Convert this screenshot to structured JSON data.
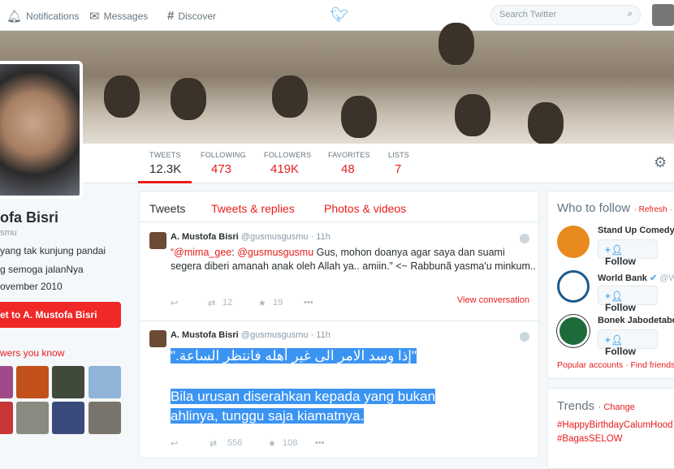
{
  "topbar": {
    "notifications": "Notifications",
    "messages": "Messages",
    "discover": "Discover",
    "search_placeholder": "Search Twitter"
  },
  "stats": [
    {
      "label": "TWEETS",
      "value": "12.3K"
    },
    {
      "label": "FOLLOWING",
      "value": "473"
    },
    {
      "label": "FOLLOWERS",
      "value": "419K"
    },
    {
      "label": "FAVORITES",
      "value": "48"
    },
    {
      "label": "LISTS",
      "value": "7"
    }
  ],
  "profile": {
    "name": "ofa Bisri",
    "handle": "smu",
    "bio1": "yang tak kunjung pandai",
    "bio2": "g semoga jalanNya",
    "joined": "ovember 2010",
    "tweet_button": "et to A. Mustofa Bisri",
    "followers_you_know": "wers you know"
  },
  "tabs": {
    "tweets": "Tweets",
    "replies": "Tweets & replies",
    "media": "Photos & videos"
  },
  "tweets": [
    {
      "name": "A. Mustofa Bisri",
      "handle": "@gusmusgusmu",
      "time": "· 11h",
      "quote_open": "“",
      "mention1": "@mima_gee",
      "colon": ": ",
      "mention2": "@gusmusgusmu",
      "text": " Gus, mohon doanya agar saya dan suami segera diberi amanah anak oleh Allah ya.. amiin.” <~ Rabbunã yasma'u minkum..",
      "retweets": "12",
      "favorites": "19",
      "view": "View conversation"
    },
    {
      "name": "A. Mustofa Bisri",
      "handle": "@gusmusgusmu",
      "time": "· 11h",
      "arabic": "\"إذا وسد الامر الى غير أهله فانتظر الساعة.\"",
      "line1": "Bila urusan diserahkan kepada yang bukan",
      "line2": "ahlinya, tunggu saja kiamatnya.",
      "retweets": "556",
      "favorites": "108"
    }
  ],
  "who_to_follow": {
    "title": "Who to follow",
    "refresh": "· Refresh ·",
    "accounts": [
      {
        "name": "Stand Up Comedy"
      },
      {
        "name": "World Bank",
        "handle": "@W"
      },
      {
        "name": "Bonek Jabodetabe"
      }
    ],
    "follow": "Follow",
    "popular": "Popular accounts",
    "find": "· Find friends"
  },
  "trends": {
    "title": "Trends",
    "change": "· Change",
    "items": [
      "#HappyBirthdayCalumHood",
      "#BagasSELOW"
    ]
  },
  "colors": {
    "accent": "#e81c1c",
    "twitter_blue": "#55acee",
    "selection": "#3b94f2"
  }
}
